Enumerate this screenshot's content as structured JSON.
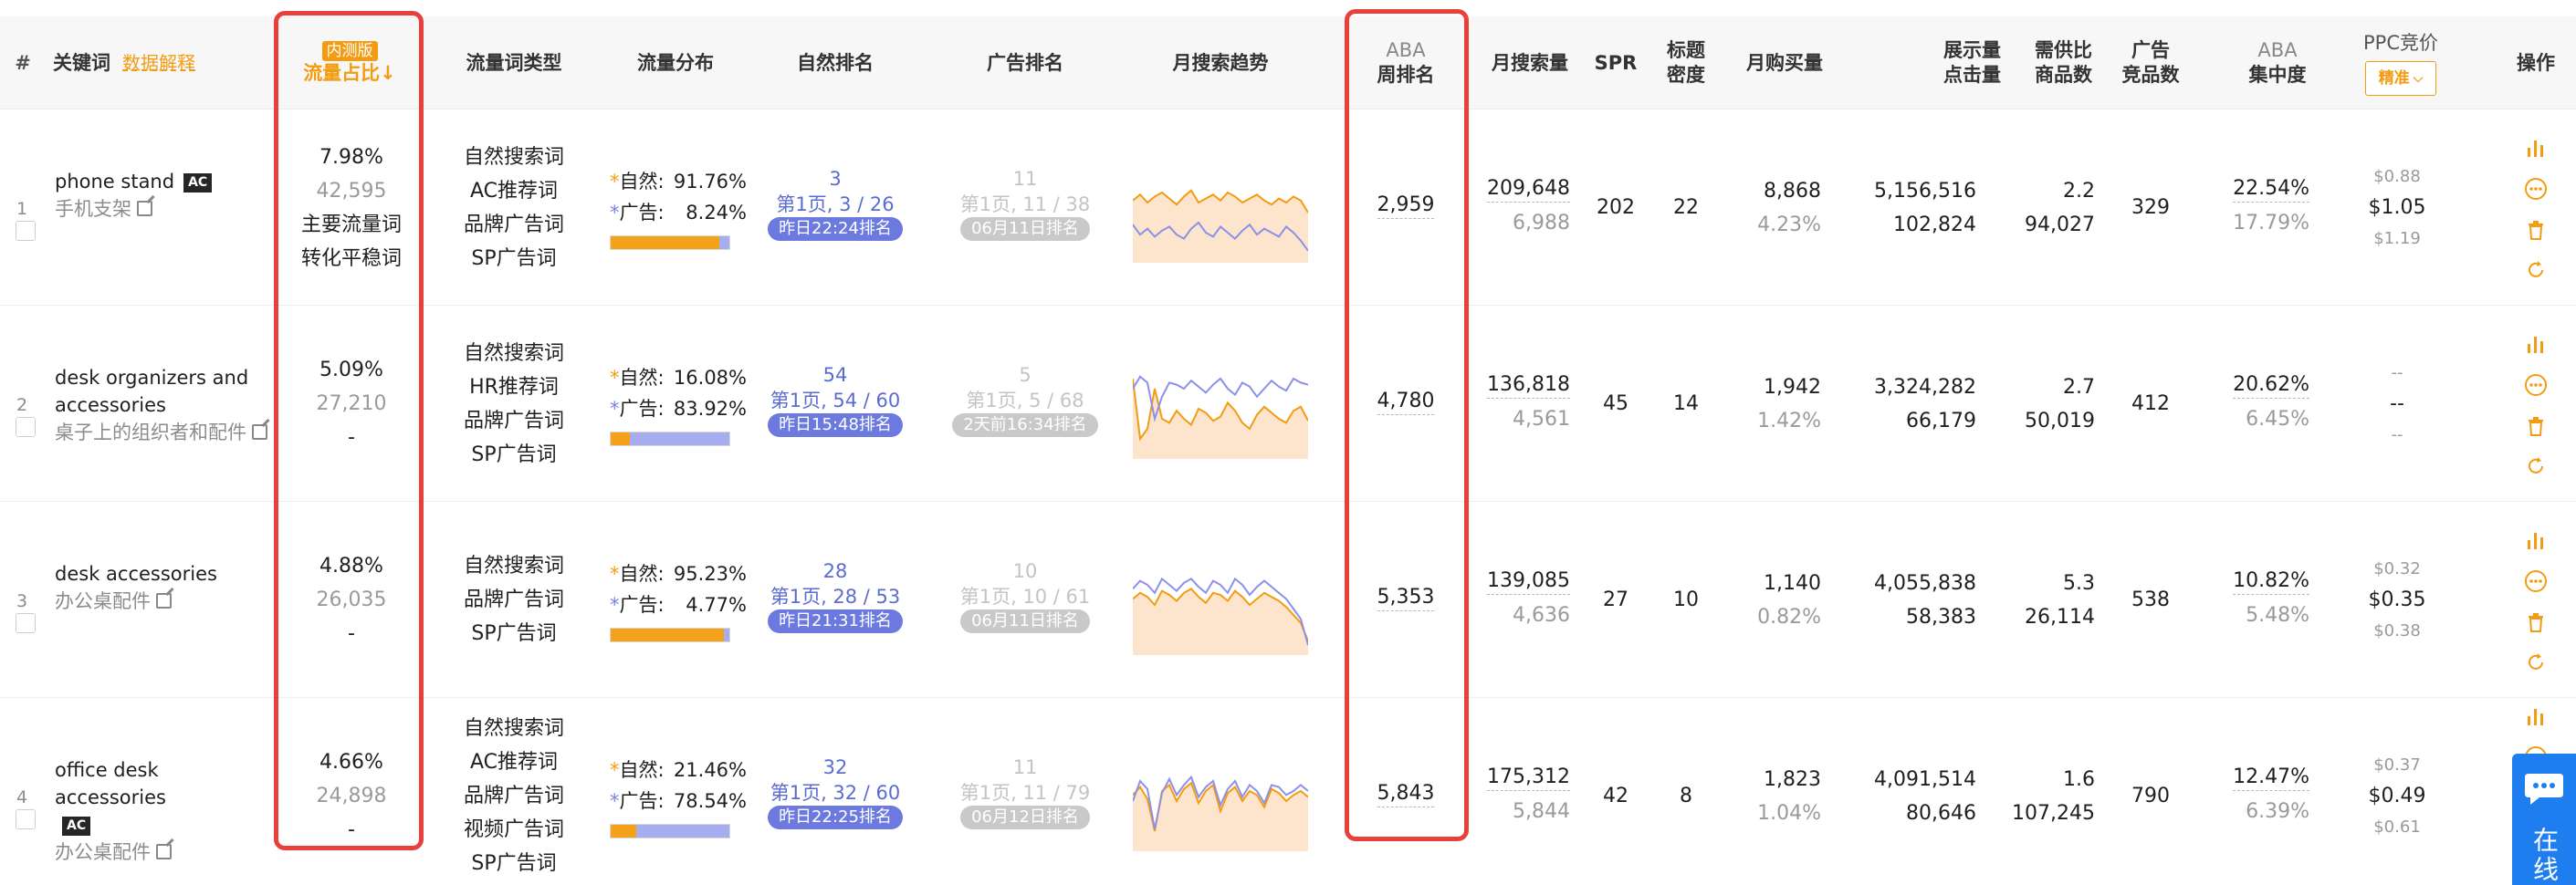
{
  "header": {
    "idx": "#",
    "keyword": "关键词",
    "data_explain": "数据解释",
    "beta_badge": "内测版",
    "traffic_share": "流量占比↓",
    "kw_type": "流量词类型",
    "traffic_dist": "流量分布",
    "natural_rank": "自然排名",
    "ad_rank": "广告排名",
    "monthly_trend": "月搜索趋势",
    "aba_rank_1": "ABA",
    "aba_rank_2": "周排名",
    "monthly_search": "月搜索量",
    "spr": "SPR",
    "title_density_1": "标题",
    "title_density_2": "密度",
    "monthly_purchase": "月购买量",
    "impr_1": "展示量",
    "impr_2": "点击量",
    "supply_1": "需供比",
    "supply_2": "商品数",
    "ad_comp_1": "广告",
    "ad_comp_2": "竞品数",
    "aba_conc_1": "ABA",
    "aba_conc_2": "集中度",
    "ppc": "PPC竞价",
    "ppc_mode": "精准",
    "ops": "操作"
  },
  "rows": [
    {
      "idx": "1",
      "kw_en": "phone stand",
      "kw_ac": "AC",
      "kw_cn": "手机支架",
      "share_pct": "7.98%",
      "share_num": "42,595",
      "share_l3": "主要流量词",
      "share_l4": "转化平稳词",
      "types": [
        "自然搜索词",
        "AC推荐词",
        "品牌广告词",
        "SP广告词"
      ],
      "natural_label": "自然:",
      "natural_pct": "91.76%",
      "ad_label": "广告:",
      "ad_pct": "8.24%",
      "ad_fill": 0.0824,
      "nat_rank": "3",
      "nat_page": "第1页, 3 / 26",
      "nat_pill": "昨日22:24排名",
      "ad_rank": "11",
      "ad_page": "第1页, 11 / 38",
      "ad_pill": "06月11日排名",
      "aba": "2,959",
      "search_main": "209,648",
      "search_sub": "6,988",
      "spr": "202",
      "density": "22",
      "purchase_main": "8,868",
      "purchase_sub": "4.23%",
      "impr": "5,156,516",
      "clicks": "102,824",
      "supply_ratio": "2.2",
      "products": "94,027",
      "ad_comp": "329",
      "conc_main": "22.54%",
      "conc_sub": "17.79%",
      "ppc_low": "$0.88",
      "ppc_mid": "$1.05",
      "ppc_high": "$1.19",
      "trend_orange": [
        62,
        68,
        60,
        66,
        70,
        64,
        58,
        66,
        72,
        60,
        64,
        68,
        62,
        70,
        66,
        60,
        64,
        68,
        62,
        58,
        64,
        60,
        66,
        62,
        50
      ],
      "trend_blue": [
        38,
        28,
        34,
        26,
        32,
        36,
        28,
        24,
        34,
        40,
        30,
        26,
        36,
        30,
        24,
        32,
        38,
        28,
        34,
        30,
        26,
        36,
        30,
        22,
        12
      ]
    },
    {
      "idx": "2",
      "kw_en": "desk organizers and",
      "kw_en2": "accessories",
      "kw_cn": "桌子上的组织者和配件",
      "share_pct": "5.09%",
      "share_num": "27,210",
      "share_l3": "-",
      "types": [
        "自然搜索词",
        "HR推荐词",
        "品牌广告词",
        "SP广告词"
      ],
      "natural_label": "自然:",
      "natural_pct": "16.08%",
      "ad_label": "广告:",
      "ad_pct": "83.92%",
      "ad_fill": 0.8392,
      "nat_rank": "54",
      "nat_page": "第1页, 54 / 60",
      "nat_pill": "昨日15:48排名",
      "ad_rank": "5",
      "ad_page": "第1页, 5 / 68",
      "ad_pill": "2天前16:34排名",
      "aba": "4,780",
      "search_main": "136,818",
      "search_sub": "4,561",
      "spr": "45",
      "density": "14",
      "purchase_main": "1,942",
      "purchase_sub": "1.42%",
      "impr": "3,324,282",
      "clicks": "66,179",
      "supply_ratio": "2.7",
      "products": "50,019",
      "ad_comp": "412",
      "conc_main": "20.62%",
      "conc_sub": "6.45%",
      "ppc_low": "--",
      "ppc_mid": "--",
      "ppc_high": "--",
      "trend_orange": [
        80,
        20,
        30,
        70,
        40,
        36,
        48,
        40,
        34,
        50,
        46,
        38,
        42,
        56,
        48,
        36,
        30,
        44,
        52,
        46,
        40,
        36,
        48,
        52,
        38
      ],
      "trend_blue": [
        70,
        82,
        76,
        40,
        62,
        76,
        74,
        70,
        78,
        72,
        66,
        74,
        80,
        70,
        64,
        76,
        72,
        62,
        70,
        78,
        72,
        68,
        80,
        76,
        74
      ]
    },
    {
      "idx": "3",
      "kw_en": "desk accessories",
      "kw_cn": "办公桌配件",
      "share_pct": "4.88%",
      "share_num": "26,035",
      "share_l3": "-",
      "types": [
        "自然搜索词",
        "品牌广告词",
        "SP广告词"
      ],
      "natural_label": "自然:",
      "natural_pct": "95.23%",
      "ad_label": "广告:",
      "ad_pct": "4.77%",
      "ad_fill": 0.0477,
      "nat_rank": "28",
      "nat_page": "第1页, 28 / 53",
      "nat_pill": "昨日21:31排名",
      "ad_rank": "10",
      "ad_page": "第1页, 10 / 61",
      "ad_pill": "06月11日排名",
      "aba": "5,353",
      "search_main": "139,085",
      "search_sub": "4,636",
      "spr": "27",
      "density": "10",
      "purchase_main": "1,140",
      "purchase_sub": "0.82%",
      "impr": "4,055,838",
      "clicks": "58,383",
      "supply_ratio": "5.3",
      "products": "26,114",
      "ad_comp": "538",
      "conc_main": "10.82%",
      "conc_sub": "5.48%",
      "ppc_low": "$0.32",
      "ppc_mid": "$0.35",
      "ppc_high": "$0.38",
      "trend_orange": [
        56,
        62,
        58,
        50,
        64,
        60,
        54,
        62,
        66,
        58,
        52,
        62,
        60,
        54,
        64,
        58,
        50,
        56,
        62,
        58,
        54,
        48,
        40,
        32,
        14
      ],
      "trend_blue": [
        66,
        74,
        70,
        62,
        76,
        70,
        64,
        72,
        76,
        68,
        62,
        74,
        70,
        62,
        76,
        70,
        60,
        68,
        74,
        68,
        62,
        56,
        46,
        36,
        10
      ]
    },
    {
      "idx": "4",
      "kw_en": "office desk accessories",
      "kw_ac": "AC",
      "kw_cn": "办公桌配件",
      "share_pct": "4.66%",
      "share_num": "24,898",
      "share_l3": "-",
      "types": [
        "自然搜索词",
        "AC推荐词",
        "品牌广告词",
        "视频广告词",
        "SP广告词"
      ],
      "natural_label": "自然:",
      "natural_pct": "21.46%",
      "ad_label": "广告:",
      "ad_pct": "78.54%",
      "ad_fill": 0.7854,
      "nat_rank": "32",
      "nat_page": "第1页, 32 / 60",
      "nat_pill": "昨日22:25排名",
      "ad_rank": "11",
      "ad_page": "第1页, 11 / 79",
      "ad_pill": "06月12日排名",
      "aba": "5,843",
      "search_main": "175,312",
      "search_sub": "5,844",
      "spr": "42",
      "density": "8",
      "purchase_main": "1,823",
      "purchase_sub": "1.04%",
      "impr": "4,091,514",
      "clicks": "80,646",
      "supply_ratio": "1.6",
      "products": "107,245",
      "ad_comp": "790",
      "conc_main": "12.47%",
      "conc_sub": "6.39%",
      "ppc_low": "$0.37",
      "ppc_mid": "$0.49",
      "ppc_high": "$0.61",
      "trend_orange": [
        56,
        64,
        52,
        20,
        60,
        66,
        50,
        62,
        68,
        48,
        60,
        66,
        40,
        58,
        64,
        50,
        60,
        56,
        44,
        62,
        58,
        50,
        56,
        60,
        54
      ],
      "trend_blue": [
        50,
        70,
        62,
        22,
        58,
        72,
        56,
        66,
        74,
        54,
        64,
        70,
        46,
        62,
        70,
        54,
        66,
        60,
        48,
        66,
        64,
        56,
        60,
        66,
        60
      ]
    }
  ],
  "online_chat": "在线",
  "colors": {
    "orange": "#f39c12",
    "blue": "#6c7ae0",
    "highlight": "#e8413c"
  }
}
